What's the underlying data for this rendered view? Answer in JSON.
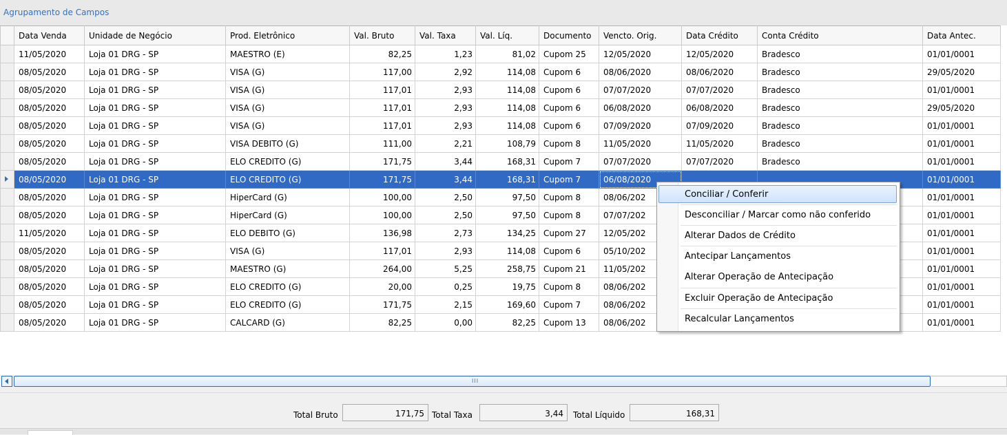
{
  "group_panel": {
    "title": "Agrupamento de Campos"
  },
  "grid": {
    "columns": [
      "Data Venda",
      "Unidade de Negócio",
      "Prod. Eletrônico",
      "Val. Bruto",
      "Val. Taxa",
      "Val. Líq.",
      "Documento",
      "Vencto. Orig.",
      "Data Crédito",
      "Conta Crédito",
      "Data Antec."
    ],
    "rows": [
      [
        "11/05/2020",
        "Loja 01 DRG - SP",
        "MAESTRO (E)",
        "82,25",
        "1,23",
        "81,02",
        "Cupom 25",
        "12/05/2020",
        "12/05/2020",
        "Bradesco",
        "01/01/0001"
      ],
      [
        "08/05/2020",
        "Loja 01 DRG - SP",
        "VISA (G)",
        "117,00",
        "2,92",
        "114,08",
        "Cupom 6",
        "08/06/2020",
        "08/06/2020",
        "Bradesco",
        "29/05/2020"
      ],
      [
        "08/05/2020",
        "Loja 01 DRG - SP",
        "VISA (G)",
        "117,01",
        "2,93",
        "114,08",
        "Cupom 6",
        "07/07/2020",
        "07/07/2020",
        "Bradesco",
        "01/01/0001"
      ],
      [
        "08/05/2020",
        "Loja 01 DRG - SP",
        "VISA (G)",
        "117,01",
        "2,93",
        "114,08",
        "Cupom 6",
        "06/08/2020",
        "06/08/2020",
        "Bradesco",
        "29/05/2020"
      ],
      [
        "08/05/2020",
        "Loja 01 DRG - SP",
        "VISA (G)",
        "117,01",
        "2,93",
        "114,08",
        "Cupom 6",
        "07/09/2020",
        "07/09/2020",
        "Bradesco",
        "01/01/0001"
      ],
      [
        "08/05/2020",
        "Loja 01 DRG - SP",
        "VISA DEBITO (G)",
        "111,00",
        "2,21",
        "108,79",
        "Cupom 8",
        "11/05/2020",
        "11/05/2020",
        "Bradesco",
        "01/01/0001"
      ],
      [
        "08/05/2020",
        "Loja 01 DRG - SP",
        "ELO CREDITO (G)",
        "171,75",
        "3,44",
        "168,31",
        "Cupom 7",
        "07/07/2020",
        "07/07/2020",
        "Bradesco",
        "01/01/0001"
      ],
      [
        "08/05/2020",
        "Loja 01 DRG - SP",
        "ELO CREDITO (G)",
        "171,75",
        "3,44",
        "168,31",
        "Cupom 7",
        "06/08/2020",
        "",
        "",
        "01/01/0001"
      ],
      [
        "08/05/2020",
        "Loja 01 DRG - SP",
        "HiperCard (G)",
        "100,00",
        "2,50",
        "97,50",
        "Cupom 8",
        "08/06/202",
        "",
        "",
        "01/01/0001"
      ],
      [
        "08/05/2020",
        "Loja 01 DRG - SP",
        "HiperCard (G)",
        "100,00",
        "2,50",
        "97,50",
        "Cupom 8",
        "07/07/202",
        "",
        "",
        "01/01/0001"
      ],
      [
        "11/05/2020",
        "Loja 01 DRG - SP",
        "ELO DEBITO (G)",
        "136,98",
        "2,73",
        "134,25",
        "Cupom 27",
        "12/05/202",
        "",
        "",
        "01/01/0001"
      ],
      [
        "08/05/2020",
        "Loja 01 DRG - SP",
        "VISA (G)",
        "117,01",
        "2,93",
        "114,08",
        "Cupom 6",
        "05/10/202",
        "",
        "",
        "01/01/0001"
      ],
      [
        "08/05/2020",
        "Loja 01 DRG - SP",
        "MAESTRO (G)",
        "264,00",
        "5,25",
        "258,75",
        "Cupom 21",
        "11/05/202",
        "",
        "",
        "01/01/0001"
      ],
      [
        "08/05/2020",
        "Loja 01 DRG - SP",
        "ELO CREDITO (G)",
        "20,00",
        "0,25",
        "19,75",
        "Cupom 8",
        "08/06/202",
        "",
        "",
        "01/01/0001"
      ],
      [
        "08/05/2020",
        "Loja 01 DRG - SP",
        "ELO CREDITO (G)",
        "171,75",
        "2,15",
        "169,60",
        "Cupom 7",
        "08/06/202",
        "",
        "",
        "01/01/0001"
      ],
      [
        "08/05/2020",
        "Loja 01 DRG - SP",
        "CALCARD (G)",
        "82,25",
        "0,00",
        "82,25",
        "Cupom 13",
        "08/06/202",
        "",
        "",
        "01/01/0001"
      ]
    ],
    "selected_row": 7,
    "colors": {
      "selection": "#316ac5",
      "group_title": "#2b74c7"
    }
  },
  "scrollbar": {
    "left_icon": "chevron-left-icon",
    "grip": "III"
  },
  "totals": {
    "bruto_label": "Total Bruto",
    "bruto_value": "171,75",
    "taxa_label": "Total Taxa",
    "taxa_value": "3,44",
    "liquido_label": "Total Líquido",
    "liquido_value": "168,31"
  },
  "context_menu": {
    "items": [
      "Conciliar / Conferir",
      "Desconciliar / Marcar como não conferido",
      "Alterar Dados de Crédito",
      "Antecipar Lançamentos",
      "Alterar Operação de Antecipação",
      "Excluir Operação de Antecipação",
      "Recalcular Lançamentos"
    ],
    "highlighted": 0
  }
}
